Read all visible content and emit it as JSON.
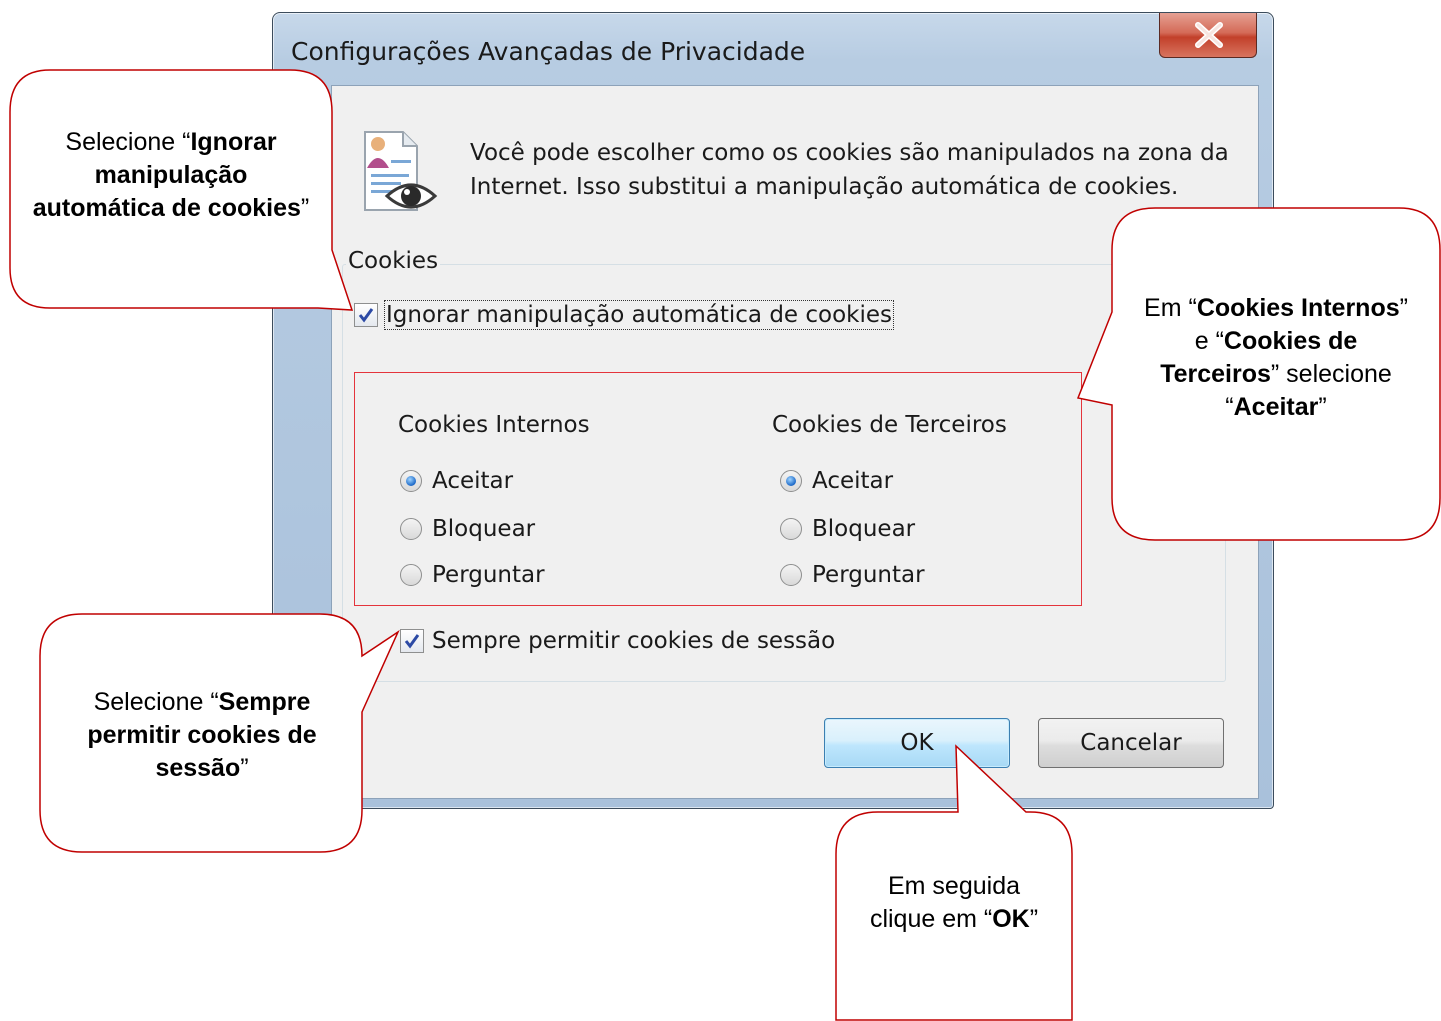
{
  "window": {
    "title": "Configurações Avançadas de Privacidade",
    "intro": "Você pode escolher como os cookies são manipulados na zona da Internet. Isso substitui a manipulação automática de cookies.",
    "group_label": "Cookies",
    "override_checkbox": {
      "label": "Ignorar manipulação automática de cookies",
      "checked": true
    },
    "first_party": {
      "heading": "Cookies Internos",
      "options": [
        "Aceitar",
        "Bloquear",
        "Perguntar"
      ],
      "selected": "Aceitar"
    },
    "third_party": {
      "heading": "Cookies de Terceiros",
      "options": [
        "Aceitar",
        "Bloquear",
        "Perguntar"
      ],
      "selected": "Aceitar"
    },
    "session_checkbox": {
      "label": "Sempre permitir cookies de sessão",
      "checked": true
    },
    "ok_label": "OK",
    "cancel_label": "Cancelar"
  },
  "callouts": {
    "c1": {
      "pre": "Selecione “",
      "bold": "Ignorar manipulação automática de cookies",
      "post": "”"
    },
    "c2": {
      "pre1": "Em “",
      "bold1": "Cookies Internos",
      "mid1": "” e “",
      "bold2": "Cookies de Terceiros",
      "mid2": "” selecione “",
      "bold3": "Aceitar",
      "post": "”"
    },
    "c3": {
      "pre": "Selecione “",
      "bold": "Sempre permitir cookies de sessão",
      "post": "”"
    },
    "c4": {
      "pre": "Em seguida clique em “",
      "bold": "OK",
      "post": "”"
    }
  },
  "colors": {
    "callout_border": "#c00000",
    "highlight_box": "#e4343c",
    "ok_border": "#3c7fb1"
  }
}
